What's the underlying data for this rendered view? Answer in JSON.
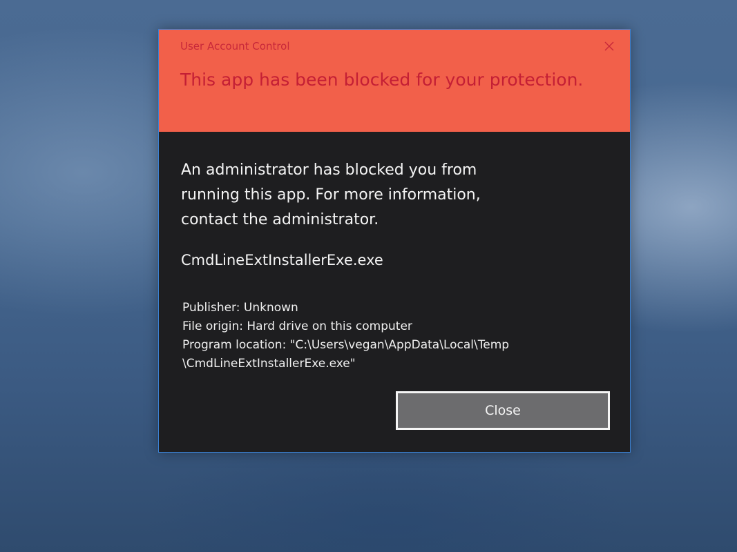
{
  "dialog": {
    "window_title": "User Account Control",
    "close_icon": "close-icon",
    "heading": "This app has been blocked for your protection.",
    "message": "An administrator has blocked you from running this app. For more information, contact the administrator.",
    "app_name": "CmdLineExtInstallerExe.exe",
    "details": {
      "publisher": "Publisher: Unknown",
      "file_origin": "File origin: Hard drive on this computer",
      "program_location_line1": "Program location: \"C:\\Users\\vegan\\AppData\\Local\\Temp",
      "program_location_line2": "\\CmdLineExtInstallerExe.exe\""
    },
    "close_button_label": "Close"
  },
  "colors": {
    "header_background": "#f2604a",
    "header_text": "#c41f35",
    "body_background": "#1e1e20",
    "body_text": "#f4f4f4",
    "dialog_border": "#3b82d4",
    "button_background": "#6c6c6e"
  }
}
